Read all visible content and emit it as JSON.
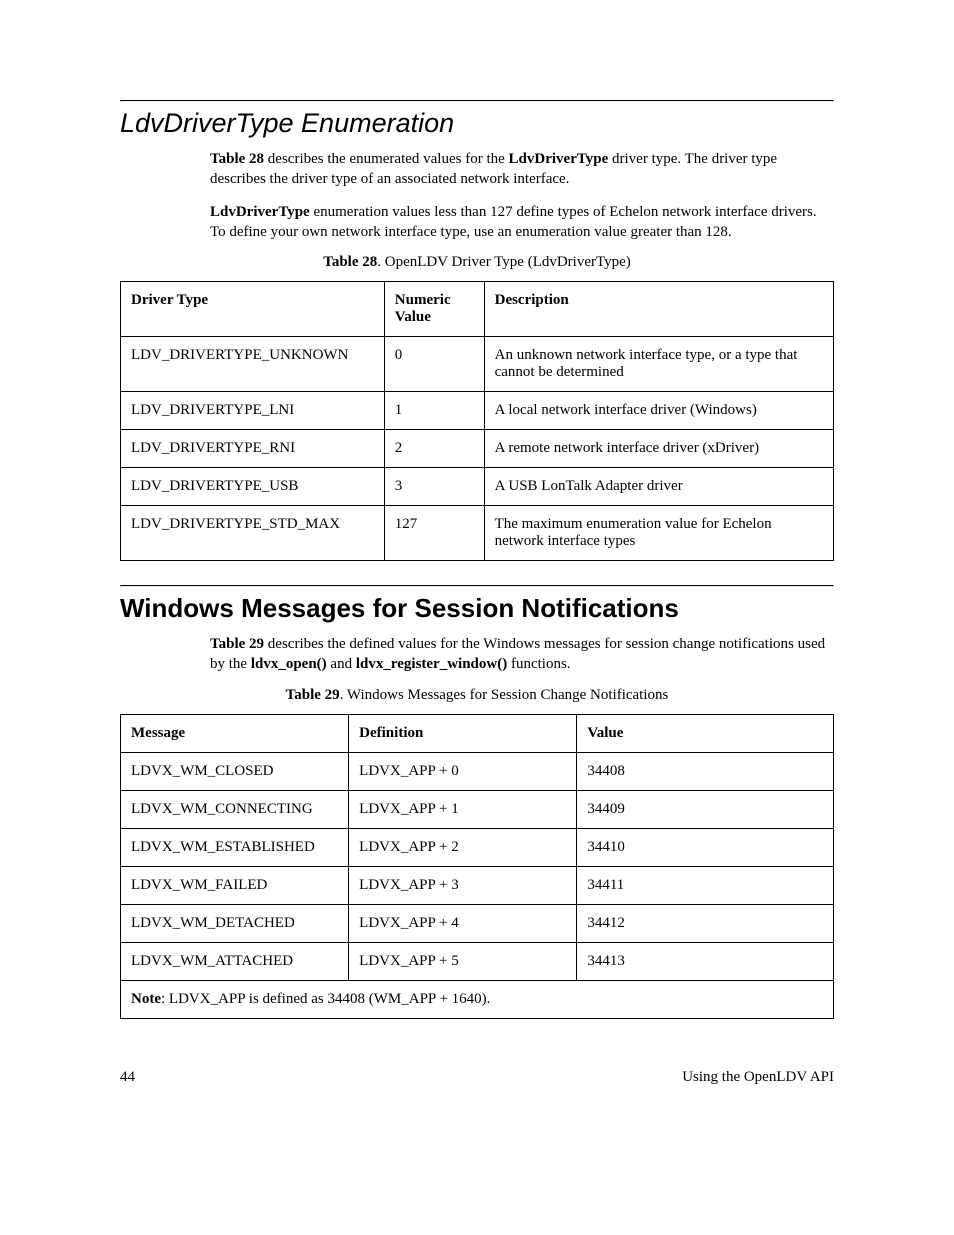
{
  "section1": {
    "heading": "LdvDriverType Enumeration",
    "para1_pre": "Table 28",
    "para1_mid": " describes the enumerated values for the ",
    "para1_bold": "LdvDriverType",
    "para1_post": " driver type. The driver type describes the driver type of an associated network interface.",
    "para2_bold": "LdvDriverType",
    "para2_post": " enumeration values less than 127 define types of Echelon network interface drivers.  To define your own network interface type, use an enumeration value greater than 128.",
    "caption_pre": "Table 28",
    "caption_post": ". OpenLDV Driver Type (LdvDriverType)"
  },
  "table28": {
    "headers": [
      "Driver Type",
      "Numeric Value",
      "Description"
    ],
    "rows": [
      [
        "LDV_DRIVERTYPE_UNKNOWN",
        "0",
        "An unknown network interface type, or a type that cannot be determined"
      ],
      [
        "LDV_DRIVERTYPE_LNI",
        "1",
        "A local network interface driver (Windows)"
      ],
      [
        "LDV_DRIVERTYPE_RNI",
        "2",
        "A remote network interface driver (xDriver)"
      ],
      [
        "LDV_DRIVERTYPE_USB",
        "3",
        "A USB LonTalk Adapter driver"
      ],
      [
        "LDV_DRIVERTYPE_STD_MAX",
        "127",
        "The maximum enumeration value for Echelon network interface types"
      ]
    ]
  },
  "section2": {
    "heading": "Windows Messages for Session Notifications",
    "para1_pre": "Table 29",
    "para1_mid": " describes the defined values for the Windows messages for session change notifications used by the ",
    "para1_bold1": "ldvx_open()",
    "para1_and": " and ",
    "para1_bold2": "ldvx_register_window()",
    "para1_post": " functions.",
    "caption_pre": "Table 29",
    "caption_post": ". Windows Messages for Session Change Notifications"
  },
  "table29": {
    "headers": [
      "Message",
      "Definition",
      "Value"
    ],
    "rows": [
      [
        "LDVX_WM_CLOSED",
        "LDVX_APP + 0",
        "34408"
      ],
      [
        "LDVX_WM_CONNECTING",
        "LDVX_APP + 1",
        "34409"
      ],
      [
        "LDVX_WM_ESTABLISHED",
        "LDVX_APP + 2",
        "34410"
      ],
      [
        "LDVX_WM_FAILED",
        "LDVX_APP + 3",
        "34411"
      ],
      [
        "LDVX_WM_DETACHED",
        "LDVX_APP + 4",
        "34412"
      ],
      [
        "LDVX_WM_ATTACHED",
        "LDVX_APP + 5",
        "34413"
      ]
    ],
    "note_label": "Note",
    "note_text": ":  LDVX_APP is defined as 34408 (WM_APP + 1640)."
  },
  "footer": {
    "left": "44",
    "right": "Using the OpenLDV API"
  }
}
